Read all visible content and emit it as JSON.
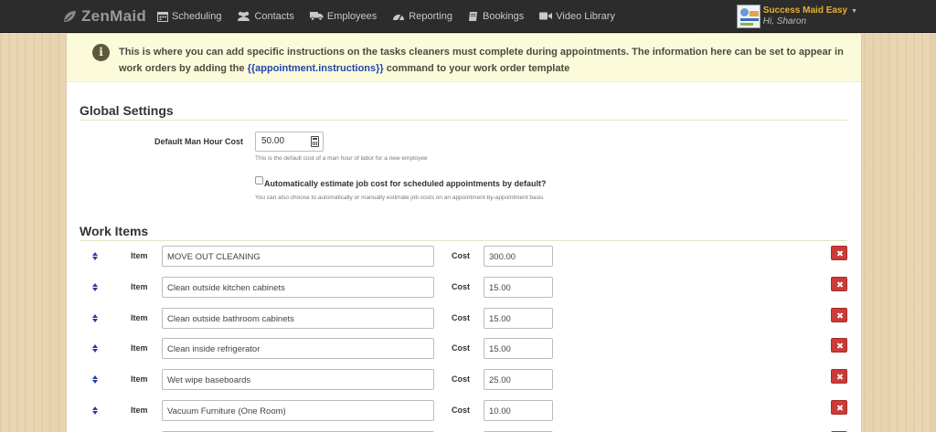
{
  "app": {
    "brand": "ZenMaid"
  },
  "nav": [
    {
      "icon": "calendar-icon",
      "label": "Scheduling"
    },
    {
      "icon": "people-icon",
      "label": "Contacts"
    },
    {
      "icon": "truck-icon",
      "label": "Employees"
    },
    {
      "icon": "dashboard-icon",
      "label": "Reporting"
    },
    {
      "icon": "book-icon",
      "label": "Bookings"
    },
    {
      "icon": "video-icon",
      "label": "Video Library"
    }
  ],
  "user": {
    "company": "Success Maid Easy",
    "greeting": "Hi, Sharon"
  },
  "info": {
    "text_before": "This is where you can add specific instructions on the tasks cleaners must complete during appointments. The information here can be set to appear in work orders by adding the ",
    "code": "{{appointment.instructions}}",
    "text_after": " command to your work order template"
  },
  "global_settings": {
    "title": "Global Settings",
    "man_hour_label": "Default Man Hour Cost",
    "man_hour_value": "50.00",
    "man_hour_help": "This is the default cost of a man hour of labor for a new employee",
    "auto_estimate_label": "Automatically estimate job cost for scheduled appointments by default?",
    "auto_estimate_checked": false,
    "auto_estimate_help": "You can also choose to automatically or manually estimate job costs on an appointment-by-appointment basis"
  },
  "work_items": {
    "title": "Work Items",
    "item_label": "Item",
    "cost_label": "Cost",
    "rows": [
      {
        "item": "MOVE OUT CLEANING",
        "cost": "300.00"
      },
      {
        "item": "Clean outside kitchen cabinets",
        "cost": "15.00"
      },
      {
        "item": "Clean outside bathroom cabinets",
        "cost": "15.00"
      },
      {
        "item": "Clean inside refrigerator",
        "cost": "15.00"
      },
      {
        "item": "Wet wipe baseboards",
        "cost": "25.00"
      },
      {
        "item": "Vacuum Furniture (One Room)",
        "cost": "10.00"
      },
      {
        "item": "",
        "cost": ""
      }
    ]
  }
}
